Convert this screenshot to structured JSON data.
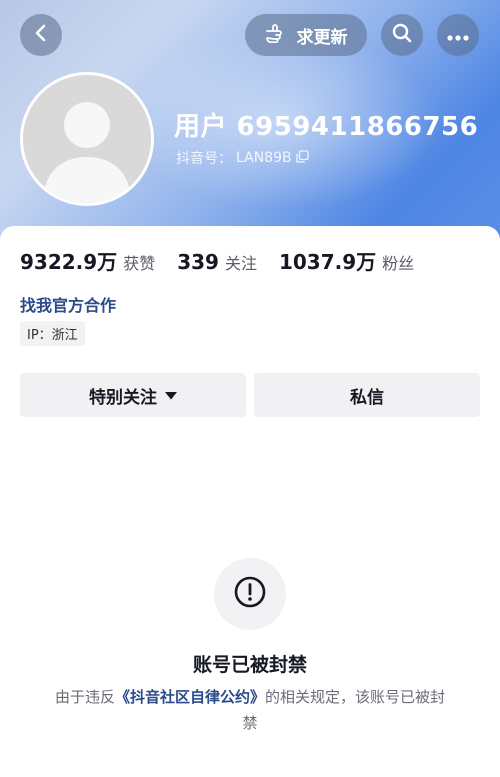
{
  "topbar": {
    "update_label": "求更新"
  },
  "profile": {
    "username": "用户 6959411866756",
    "douyin_id_label": "抖音号：",
    "douyin_id": "LAN89B"
  },
  "stats": [
    {
      "value": "9322.9万",
      "label": "获赞"
    },
    {
      "value": "339",
      "label": "关注"
    },
    {
      "value": "1037.9万",
      "label": "粉丝"
    }
  ],
  "coop_link": "找我官方合作",
  "ip_tag": "IP：浙江",
  "actions": {
    "follow_label": "特别关注",
    "message_label": "私信"
  },
  "ban": {
    "title": "账号已被封禁",
    "desc_prefix": "由于违反",
    "policy_name": "《抖音社区自律公约》",
    "desc_suffix": "的相关规定，该账号已被封禁"
  },
  "colors": {
    "link": "#2b4a8a",
    "text_primary": "#161823",
    "text_secondary": "#6b6d76"
  }
}
